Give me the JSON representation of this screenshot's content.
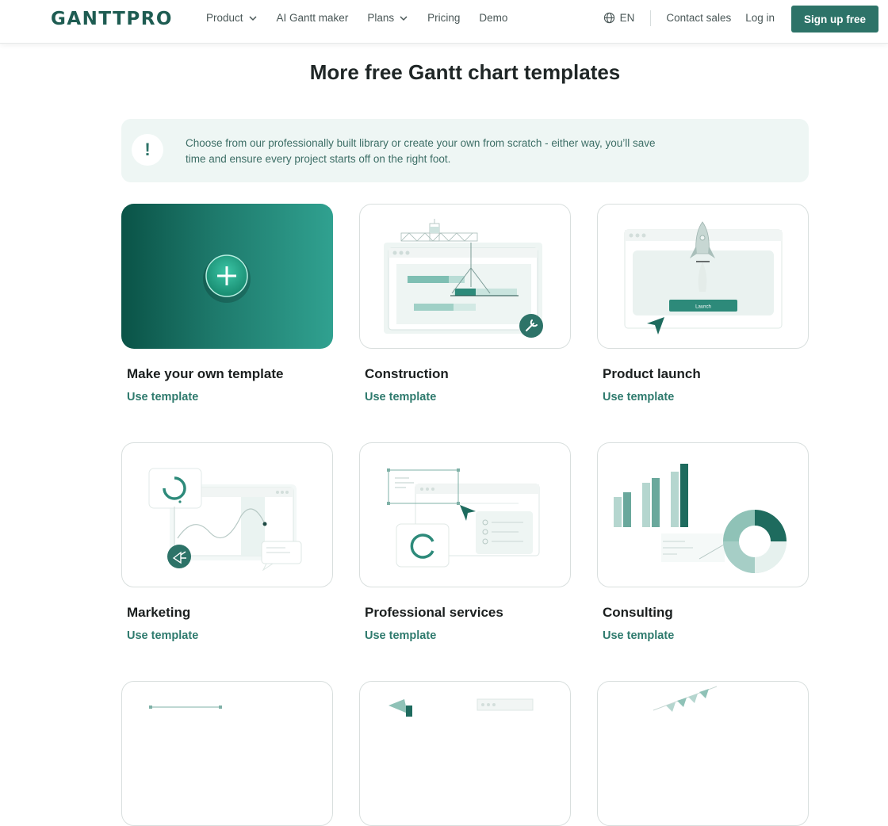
{
  "header": {
    "logo": "GANTTPRO",
    "nav": [
      "Product",
      "AI Gantt maker",
      "Plans",
      "Pricing",
      "Demo"
    ],
    "lang": "EN",
    "contact": "Contact sales",
    "login": "Log in",
    "signup": "Sign up free"
  },
  "page_title": "More free Gantt chart templates",
  "notice": {
    "icon": "!",
    "text": "Choose from our professionally built library or create your own from scratch - either way, you’ll save time and ensure every project starts off on the right foot."
  },
  "cards": [
    {
      "title": "Make your own template",
      "link": "Use template"
    },
    {
      "title": "Construction",
      "link": "Use template"
    },
    {
      "title": "Product launch",
      "link": "Use template",
      "button_label": "Launch"
    },
    {
      "title": "Marketing",
      "link": "Use template"
    },
    {
      "title": "Professional services",
      "link": "Use template"
    },
    {
      "title": "Consulting",
      "link": "Use template"
    }
  ],
  "colors": {
    "brand": "#2d7368",
    "accent": "#1e7a6c",
    "notice_bg": "#eef6f4"
  }
}
